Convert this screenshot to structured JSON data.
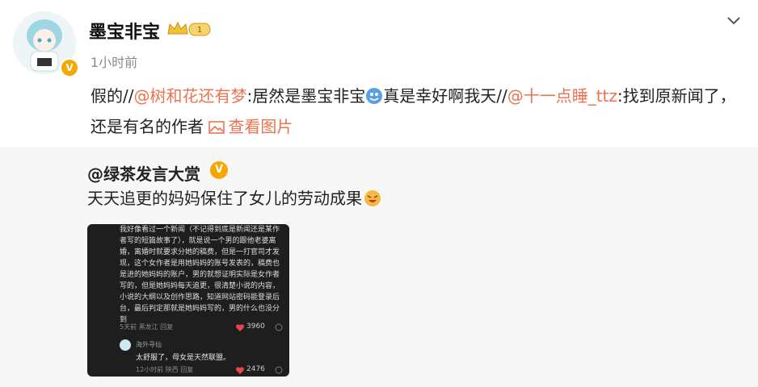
{
  "post": {
    "username": "墨宝非宝",
    "badge": "1",
    "time": "1小时前",
    "text_prefix": "假的//",
    "mention1": "@树和花还有梦",
    "text_mid1": ":居然是墨宝非宝",
    "text_mid2": "真是幸好啊我天//",
    "mention2": "@十一点睡_ttz",
    "text_mid3": ":找到原新闻了，还是有名的作者",
    "view_image": "查看图片"
  },
  "repost": {
    "username": "@绿茶发言大赏",
    "text": "天天追更的妈妈保住了女儿的劳动成果",
    "thumbnail": {
      "comment": "我好像看过一个新闻（不记得到底是新闻还是某作者写的短篇故事了），就是说一个男的跟他老婆离婚，离婚时就要求分她的稿费，但是一打官司才发现，这个女作者是用她妈妈的账号发表的，稿费也是进的她妈妈的账户，男的就想证明实际是女作者写的，但是她妈妈每天追更，很清楚小说的内容，小说的大纲以及创作思路，知道网站密码能登录后台，最后判定那就是她妈妈写的，男的什么也没分到",
      "comment_meta": "5天前 黑龙江 回复",
      "comment_likes": "3960",
      "reply_name": "海外寻仙",
      "reply_text": "太舒服了，母女是天然联盟。",
      "reply_meta": "12小时前 陕西 回复",
      "reply_likes": "2476"
    }
  },
  "colors": {
    "accent": "#eb7350",
    "vip": "#f7a800",
    "repost_bg": "#f7f7f7"
  }
}
